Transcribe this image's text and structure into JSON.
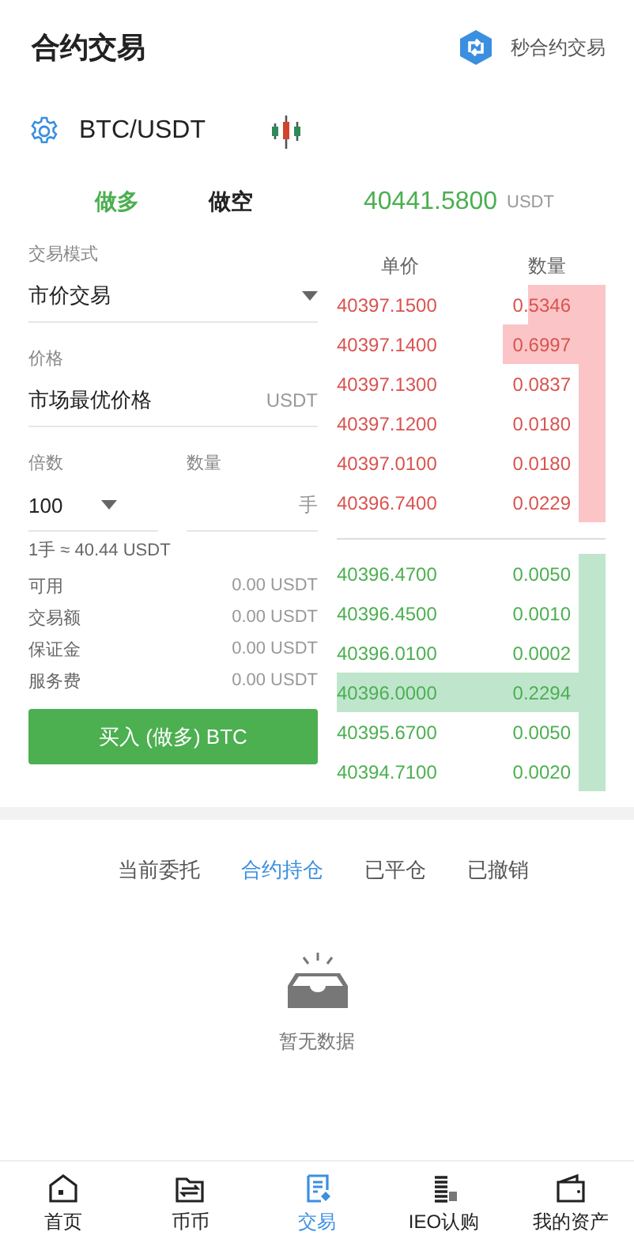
{
  "header": {
    "title": "合约交易",
    "link": "秒合约交易"
  },
  "pair": {
    "symbol": "BTC/USDT"
  },
  "side_tabs": [
    {
      "label": "做多",
      "selected": true
    },
    {
      "label": "做空",
      "selected": false
    }
  ],
  "last_price": {
    "value": "40441.5800",
    "unit": "USDT"
  },
  "form": {
    "mode_label": "交易模式",
    "mode_value": "市价交易",
    "price_label": "价格",
    "price_value": "市场最优价格",
    "price_unit": "USDT",
    "leverage_label": "倍数",
    "leverage_value": "100",
    "amount_label": "数量",
    "amount_unit": "手",
    "lot_note": "1手 ≈ 40.44 USDT",
    "info": [
      {
        "label": "可用",
        "value": "0.00 USDT"
      },
      {
        "label": "交易额",
        "value": "0.00 USDT"
      },
      {
        "label": "保证金",
        "value": "0.00 USDT"
      },
      {
        "label": "服务费",
        "value": "0.00 USDT"
      }
    ],
    "submit": "买入 (做多) BTC"
  },
  "order_book": {
    "columns": [
      "单价",
      "数量"
    ],
    "asks": [
      {
        "price": "40397.1500",
        "amount": "0.5346"
      },
      {
        "price": "40397.1400",
        "amount": "0.6997"
      },
      {
        "price": "40397.1300",
        "amount": "0.0837"
      },
      {
        "price": "40397.1200",
        "amount": "0.0180"
      },
      {
        "price": "40397.0100",
        "amount": "0.0180"
      },
      {
        "price": "40396.7400",
        "amount": "0.0229"
      }
    ],
    "bids": [
      {
        "price": "40396.4700",
        "amount": "0.0050"
      },
      {
        "price": "40396.4500",
        "amount": "0.0010"
      },
      {
        "price": "40396.0100",
        "amount": "0.0002"
      },
      {
        "price": "40396.0000",
        "amount": "0.2294"
      },
      {
        "price": "40395.6700",
        "amount": "0.0050"
      },
      {
        "price": "40394.7100",
        "amount": "0.0020"
      }
    ]
  },
  "order_tabs": [
    {
      "label": "当前委托",
      "selected": false
    },
    {
      "label": "合约持仓",
      "selected": true
    },
    {
      "label": "已平仓",
      "selected": false
    },
    {
      "label": "已撤销",
      "selected": false
    }
  ],
  "empty_text": "暂无数据",
  "bottom_nav": [
    {
      "kind": "home",
      "label": "首页",
      "selected": false
    },
    {
      "kind": "exchange",
      "label": "币币",
      "selected": false
    },
    {
      "kind": "trade",
      "label": "交易",
      "selected": true
    },
    {
      "kind": "ieo",
      "label": "IEO认购",
      "selected": false
    },
    {
      "kind": "wallet",
      "label": "我的资产",
      "selected": false
    }
  ]
}
